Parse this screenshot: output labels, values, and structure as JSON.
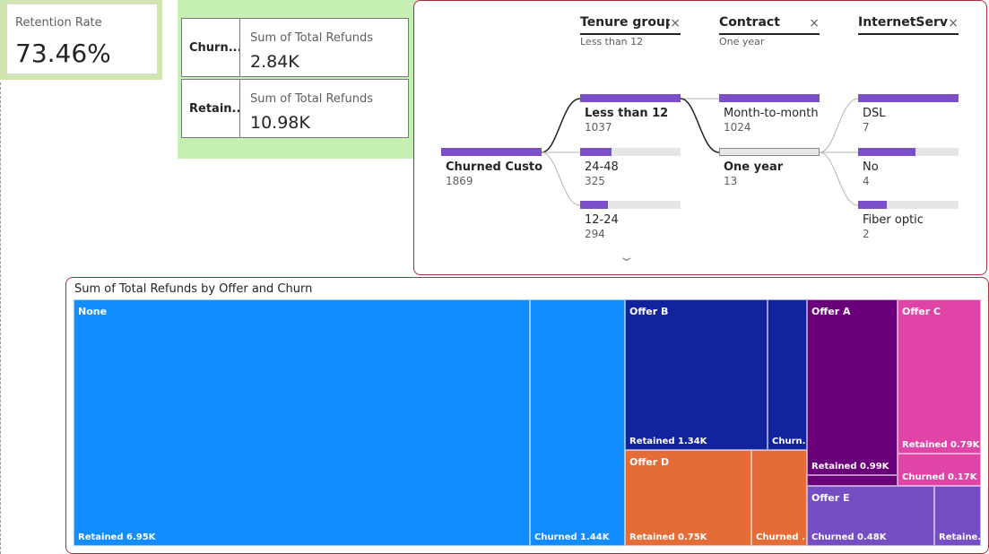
{
  "retention": {
    "title": "Retention Rate",
    "value": "73.46%"
  },
  "refund_cards": [
    {
      "label": "Churn...",
      "caption": "Sum of Total Refunds",
      "value": "2.84K"
    },
    {
      "label": "Retain...",
      "caption": "Sum of Total Refunds",
      "value": "10.98K"
    }
  ],
  "decomposition": {
    "levels": [
      {
        "title": "Tenure groups",
        "filter": "Less than 12"
      },
      {
        "title": "Contract",
        "filter": "One year"
      },
      {
        "title": "InternetServi...",
        "filter": ""
      }
    ],
    "close_glyph": "×",
    "root": {
      "name": "Churned Custo...",
      "count": "1869",
      "fill": 1.0
    },
    "tenure": [
      {
        "name": "Less than 12",
        "count": "1037",
        "fill": 1.0
      },
      {
        "name": "24-48",
        "count": "325",
        "fill": 0.31
      },
      {
        "name": "12-24",
        "count": "294",
        "fill": 0.28
      }
    ],
    "contract": [
      {
        "name": "Month-to-month",
        "count": "1024",
        "fill": 1.0
      },
      {
        "name": "One year",
        "count": "13",
        "fill": 0.0
      }
    ],
    "internet": [
      {
        "name": "DSL",
        "count": "7",
        "fill": 1.0
      },
      {
        "name": "No",
        "count": "4",
        "fill": 0.57
      },
      {
        "name": "Fiber optic",
        "count": "2",
        "fill": 0.29
      }
    ],
    "expand_glyph": "⌄"
  },
  "treemap": {
    "title": "Sum of Total Refunds by Offer and Churn",
    "tiles": [
      {
        "group": "None",
        "label": "Retained 6.95K",
        "color": "#118dff"
      },
      {
        "group": "",
        "label": "Churned 1.44K",
        "color": "#118dff"
      },
      {
        "group": "Offer B",
        "label": "Retained 1.34K",
        "color": "#12239e"
      },
      {
        "group": "",
        "label": "Churn...",
        "color": "#12239e"
      },
      {
        "group": "Offer D",
        "label": "Retained 0.75K",
        "color": "#e66c37"
      },
      {
        "group": "",
        "label": "Churned ...",
        "color": "#e66c37"
      },
      {
        "group": "Offer A",
        "label": "Retained 0.99K",
        "color": "#6b007b"
      },
      {
        "group": "",
        "label": "",
        "color": "#6b007b"
      },
      {
        "group": "Offer C",
        "label": "Retained 0.79K",
        "color": "#e044a7"
      },
      {
        "group": "",
        "label": "Churned 0.17K",
        "color": "#e044a7"
      },
      {
        "group": "Offer E",
        "label": "Churned 0.48K",
        "color": "#744ec2"
      },
      {
        "group": "",
        "label": "Retaine...",
        "color": "#744ec2"
      }
    ]
  }
}
